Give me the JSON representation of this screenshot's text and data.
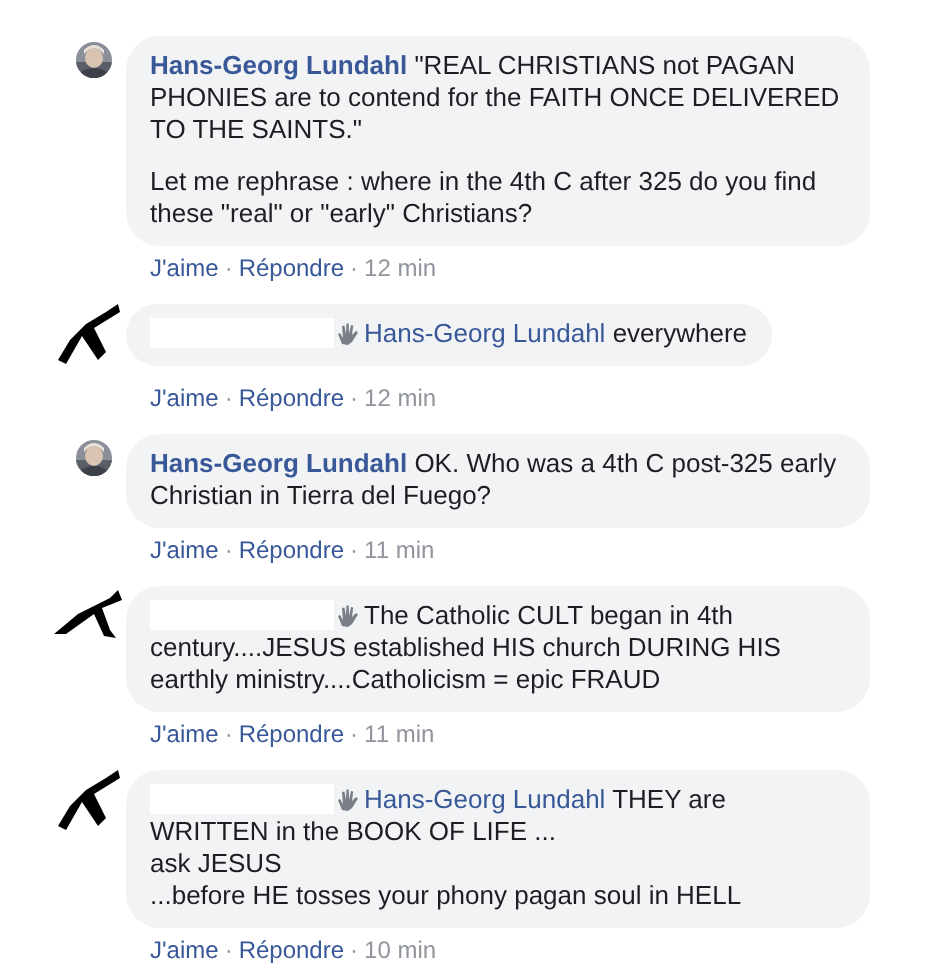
{
  "separator": "·",
  "comments": [
    {
      "kind": "own",
      "author": "Hans-Georg Lundahl",
      "paragraphs": [
        "\"REAL CHRISTIANS not PAGAN PHONIES are to contend for the FAITH ONCE DELIVERED TO THE SAINTS.\"",
        "Let me rephrase : where in the 4th C after 325 do you find these \"real\" or \"early\" Christians?"
      ],
      "like": "J'aime",
      "reply": "Répondre",
      "time": "12 min"
    },
    {
      "kind": "redacted",
      "mention": "Hans-Georg Lundahl",
      "lines": [
        "everywhere"
      ],
      "like": "J'aime",
      "reply": "Répondre",
      "time": "12 min"
    },
    {
      "kind": "own",
      "author": "Hans-Georg Lundahl",
      "paragraphs": [
        "OK. Who was a 4th C post-325 early Christian in Tierra del Fuego?"
      ],
      "like": "J'aime",
      "reply": "Répondre",
      "time": "11 min"
    },
    {
      "kind": "redacted",
      "lines": [
        "The Catholic CULT began in 4th century....JESUS established HIS church DURING HIS earthly ministry....Catholicism = epic FRAUD"
      ],
      "like": "J'aime",
      "reply": "Répondre",
      "time": "11 min"
    },
    {
      "kind": "redacted",
      "mention": "Hans-Georg Lundahl",
      "lines": [
        "THEY are WRITTEN in the BOOK OF LIFE ...",
        "ask JESUS",
        "...before HE tosses your phony pagan soul in HELL"
      ],
      "like": "J'aime",
      "reply": "Répondre",
      "time": "10 min"
    }
  ]
}
